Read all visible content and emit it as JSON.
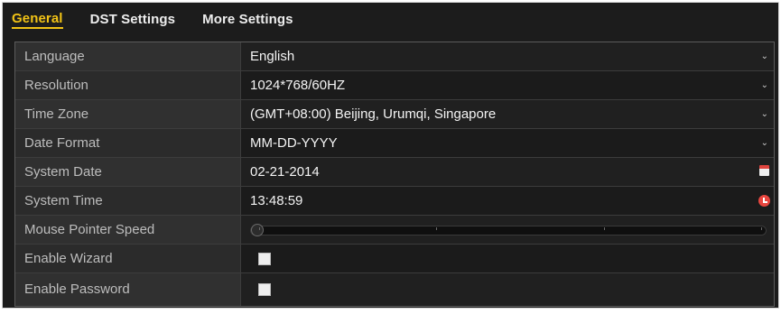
{
  "tabs": [
    {
      "label": "General",
      "active": true
    },
    {
      "label": "DST Settings",
      "active": false
    },
    {
      "label": "More Settings",
      "active": false
    }
  ],
  "settings": {
    "language": {
      "label": "Language",
      "value": "English"
    },
    "resolution": {
      "label": "Resolution",
      "value": "1024*768/60HZ"
    },
    "time_zone": {
      "label": "Time Zone",
      "value": "(GMT+08:00) Beijing, Urumqi, Singapore"
    },
    "date_format": {
      "label": "Date Format",
      "value": "MM-DD-YYYY"
    },
    "system_date": {
      "label": "System Date",
      "value": "02-21-2014"
    },
    "system_time": {
      "label": "System Time",
      "value": "13:48:59"
    },
    "mouse_pointer_speed": {
      "label": "Mouse Pointer Speed",
      "level": 0.0
    },
    "enable_wizard": {
      "label": "Enable Wizard",
      "checked": false
    },
    "enable_password": {
      "label": "Enable Password",
      "checked": false
    }
  },
  "icons": {
    "dropdown": "chevron-down-icon",
    "calendar": "calendar-icon",
    "clock": "clock-icon"
  },
  "colors": {
    "active_tab": "#f2c316",
    "calendar_accent": "#e0443e",
    "clock_accent": "#e8463f"
  }
}
